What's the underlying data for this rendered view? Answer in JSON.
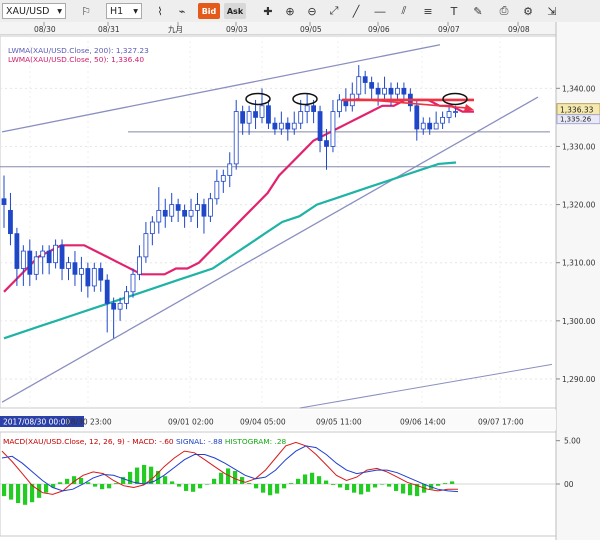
{
  "toolbar": {
    "symbol": "XAU/USD",
    "timeframe": "H1",
    "bid_label": "Bid",
    "ask_label": "Ask"
  },
  "top_dates": [
    "08/30",
    "08/31",
    "九月",
    "09/03",
    "09/05",
    "09/06",
    "09/07",
    "09/08"
  ],
  "legend": {
    "lwma200": "LWMA(XAU/USD.Close, 200): 1,327.23",
    "lwma50": "LWMA(XAU/USD.Close, 50): 1,336.40"
  },
  "macd_legend": {
    "title": "MACD(XAU/USD.Close, 12, 26, 9) -",
    "macd": "MACD: -.60",
    "signal": "SIGNAL: -.88",
    "hist": "HISTOGRAM: .28"
  },
  "colors": {
    "candle": "#1f47c8",
    "lwma50": "#e2226e",
    "lwma200": "#1fb3a6",
    "channel": "#8a8fc0",
    "resistance": "#ee3344",
    "macd_line": "#d81a1a",
    "signal_line": "#1f3fd0",
    "histogram": "#22cc22",
    "current_price_tag": "#f6e9b0"
  },
  "chart_data": [
    {
      "type": "candlestick",
      "title": "",
      "symbol": "XAU/USD",
      "timeframe": "H1",
      "x_labels": [
        "2017/08/30 00:00",
        "08/30 23:00",
        "09/01 02:00",
        "09/04 05:00",
        "09/05 11:00",
        "09/06 14:00",
        "09/07 17:00"
      ],
      "y_ticks": [
        1290,
        1300,
        1310,
        1320,
        1330,
        1340
      ],
      "y_tick_labels": [
        "1,290.00",
        "1,300.00",
        "1,310.00",
        "1,320.00",
        "1,330.00",
        "1,340.00"
      ],
      "ylim": [
        1285,
        1349
      ],
      "current_price": 1336.33,
      "current_price_label": "1,336.33",
      "secondary_price_label": "1,335.26",
      "candles": [
        [
          1321,
          1320,
          1316,
          1325
        ],
        [
          1319,
          1315,
          1313,
          1322
        ],
        [
          1315,
          1309,
          1306,
          1316
        ],
        [
          1309,
          1312,
          1306,
          1313
        ],
        [
          1312,
          1308,
          1306,
          1314
        ],
        [
          1308,
          1311,
          1307,
          1312
        ],
        [
          1311,
          1312,
          1308,
          1313
        ],
        [
          1312,
          1310,
          1308,
          1313
        ],
        [
          1310,
          1313,
          1309,
          1314
        ],
        [
          1313,
          1309,
          1307,
          1314
        ],
        [
          1309,
          1310,
          1307,
          1311
        ],
        [
          1310,
          1308,
          1306,
          1312
        ],
        [
          1308,
          1309,
          1305,
          1311
        ],
        [
          1309,
          1306,
          1304,
          1310
        ],
        [
          1306,
          1309,
          1305,
          1310
        ],
        [
          1309,
          1307,
          1305,
          1310
        ],
        [
          1307,
          1303,
          1298,
          1308
        ],
        [
          1303,
          1302,
          1297,
          1304
        ],
        [
          1302,
          1303,
          1300,
          1304
        ],
        [
          1303,
          1305,
          1302,
          1306
        ],
        [
          1305,
          1308,
          1304,
          1309
        ],
        [
          1308,
          1311,
          1307,
          1313
        ],
        [
          1311,
          1315,
          1310,
          1317
        ],
        [
          1315,
          1317,
          1313,
          1318
        ],
        [
          1317,
          1319,
          1315,
          1323
        ],
        [
          1319,
          1318,
          1316,
          1321
        ],
        [
          1318,
          1320,
          1317,
          1322
        ],
        [
          1320,
          1319,
          1317,
          1321
        ],
        [
          1319,
          1318,
          1316,
          1320
        ],
        [
          1318,
          1319,
          1317,
          1321
        ],
        [
          1319,
          1320,
          1316,
          1322
        ],
        [
          1320,
          1318,
          1315,
          1321
        ],
        [
          1318,
          1321,
          1317,
          1322
        ],
        [
          1321,
          1324,
          1320,
          1326
        ],
        [
          1324,
          1325,
          1322,
          1326
        ],
        [
          1325,
          1327,
          1323,
          1329
        ],
        [
          1327,
          1336,
          1326,
          1338
        ],
        [
          1336,
          1334,
          1332,
          1337
        ],
        [
          1334,
          1336,
          1332,
          1337
        ],
        [
          1336,
          1335,
          1333,
          1338
        ],
        [
          1335,
          1337,
          1334,
          1340
        ],
        [
          1337,
          1334,
          1333,
          1338
        ],
        [
          1334,
          1333,
          1332,
          1335
        ],
        [
          1333,
          1334,
          1332,
          1336
        ],
        [
          1334,
          1333,
          1331,
          1335
        ],
        [
          1333,
          1334,
          1332,
          1336
        ],
        [
          1334,
          1336,
          1333,
          1338
        ],
        [
          1336,
          1337,
          1334,
          1339
        ],
        [
          1337,
          1336,
          1334,
          1338
        ],
        [
          1336,
          1331,
          1329,
          1337
        ],
        [
          1331,
          1330,
          1326,
          1333
        ],
        [
          1330,
          1336,
          1329,
          1338
        ],
        [
          1336,
          1338,
          1335,
          1339
        ],
        [
          1338,
          1337,
          1336,
          1340
        ],
        [
          1337,
          1339,
          1336,
          1341
        ],
        [
          1339,
          1342,
          1338,
          1344
        ],
        [
          1342,
          1341,
          1339,
          1343
        ],
        [
          1341,
          1340,
          1338,
          1342
        ],
        [
          1340,
          1339,
          1337,
          1341
        ],
        [
          1339,
          1340,
          1338,
          1342
        ],
        [
          1340,
          1339,
          1337,
          1341
        ],
        [
          1339,
          1340,
          1338,
          1341
        ],
        [
          1340,
          1339,
          1338,
          1341
        ],
        [
          1339,
          1337,
          1336,
          1340
        ],
        [
          1337,
          1333,
          1331,
          1338
        ],
        [
          1333,
          1334,
          1332,
          1335
        ],
        [
          1334,
          1333,
          1332,
          1335
        ],
        [
          1333,
          1334,
          1333,
          1336
        ],
        [
          1334,
          1335,
          1333,
          1336
        ],
        [
          1335,
          1336,
          1334,
          1337
        ],
        [
          1336,
          1336,
          1335,
          1337
        ]
      ],
      "series": [
        {
          "name": "LWMA(XAU/USD.Close, 200)",
          "last_value": 1327.23
        },
        {
          "name": "LWMA(XAU/USD.Close, 50)",
          "last_value": 1336.4
        }
      ],
      "lwma50": [
        1305,
        1307,
        1309,
        1311,
        1312,
        1313,
        1313,
        1313,
        1312,
        1311,
        1310,
        1309,
        1308,
        1308,
        1308,
        1309,
        1309,
        1310,
        1312,
        1314,
        1316,
        1318,
        1320,
        1322,
        1325,
        1327,
        1329,
        1331,
        1332,
        1333,
        1334,
        1335,
        1336,
        1337,
        1337,
        1338,
        1338,
        1338,
        1337,
        1337,
        1336,
        1336
      ],
      "lwma200": [
        1297,
        1298,
        1299,
        1300,
        1301,
        1302,
        1303,
        1304,
        1305,
        1306,
        1307,
        1308,
        1309,
        1311,
        1313,
        1315,
        1317,
        1318,
        1320,
        1321,
        1322,
        1323,
        1324,
        1325,
        1326,
        1327,
        1327.23
      ],
      "horizontal_levels": [
        1332.5,
        1326.5
      ],
      "resistance_level": 1338
    },
    {
      "type": "line",
      "title": "MACD(XAU/USD.Close, 12, 26, 9)",
      "series": [
        {
          "name": "MACD",
          "last_value": -0.6
        },
        {
          "name": "SIGNAL",
          "last_value": -0.88
        },
        {
          "name": "HISTOGRAM",
          "last_value": 0.28
        }
      ],
      "y_ticks": [
        5,
        0
      ],
      "y_tick_labels": [
        "5.00",
        "00"
      ],
      "ylim": [
        -6,
        6
      ]
    }
  ]
}
